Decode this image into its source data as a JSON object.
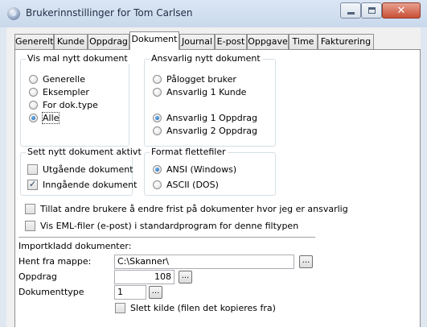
{
  "window": {
    "title": "Brukerinnstillinger for Tom Carlsen"
  },
  "tabs": [
    "Generelt",
    "Kunde",
    "Oppdrag",
    "Dokument",
    "Journal",
    "E-post",
    "Oppgave",
    "Time",
    "Fakturering"
  ],
  "active_tab": "Dokument",
  "vis_mal": {
    "title": "Vis mal nytt dokument",
    "options": [
      "Generelle",
      "Eksempler",
      "For dok.type",
      "Alle"
    ],
    "selected": "Alle"
  },
  "ansvarlig": {
    "title": "Ansvarlig nytt dokument",
    "options": [
      "Pålogget bruker",
      "Ansvarlig 1 Kunde",
      "Ansvarlig 1 Oppdrag",
      "Ansvarlig 2 Oppdrag"
    ],
    "selected": "Ansvarlig 1 Oppdrag"
  },
  "sett_aktivt": {
    "title": "Sett nytt dokument aktivt",
    "utgaende": {
      "label": "Utgående dokument",
      "checked": false
    },
    "inngaende": {
      "label": "Inngående dokument",
      "checked": true
    }
  },
  "format": {
    "title": "Format flettefiler",
    "options": [
      "ANSI (Windows)",
      "ASCII (DOS)"
    ],
    "selected": "ANSI (Windows)"
  },
  "tillat_frist": {
    "label": "Tillat andre brukere å endre frist på dokumenter hvor jeg er ansvarlig",
    "checked": false
  },
  "vis_eml": {
    "label": "Vis EML-filer (e-post) i standardprogram for denne filtypen",
    "checked": false
  },
  "import": {
    "title": "Importkladd dokumenter:",
    "hent_label": "Hent fra mappe:",
    "hent_value": "C:\\Skanner\\",
    "oppdrag_label": "Oppdrag",
    "oppdrag_value": "108",
    "doktype_label": "Dokumenttype",
    "doktype_value": "1",
    "browse_label": "...",
    "slett_kilde": {
      "label": "Slett kilde (filen det kopieres fra)",
      "checked": false
    }
  }
}
